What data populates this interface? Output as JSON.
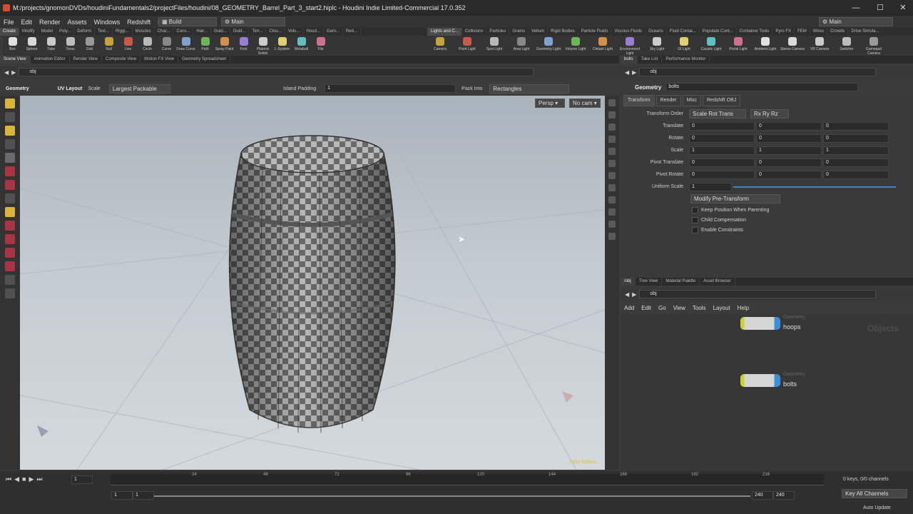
{
  "window": {
    "title": "M:/projects/gnomonDVDs/houdiniFundamentals2/projectFiles/houdini/08_GEOMETRY_Barrel_Part_3_start2.hiplc - Houdini Indie Limited-Commercial 17.0.352",
    "minimize": "—",
    "maximize": "☐",
    "close": "✕"
  },
  "menu": [
    "File",
    "Edit",
    "Render",
    "Assets",
    "Windows",
    "Redshift",
    "Help"
  ],
  "desktop": {
    "label": "Build"
  },
  "main_desk": {
    "label": "Main"
  },
  "right_desk": {
    "label": "Main"
  },
  "shelf_left": {
    "tabs": [
      "Create",
      "Modify",
      "Model",
      "Poly...",
      "Deform",
      "Text...",
      "Riggi...",
      "Muscles",
      "Char...",
      "Cons...",
      "Hair...",
      "Guid...",
      "Guid...",
      "Terr...",
      "Clou...",
      "Volu...",
      "Houd...",
      "Gam...",
      "Red..."
    ],
    "tools": [
      "Box",
      "Sphere",
      "Tube",
      "Torus",
      "Grid",
      "Null",
      "Line",
      "Circle",
      "Curve",
      "Draw Curve",
      "Path",
      "Spray Paint",
      "Font",
      "Platonic Solids",
      "L-System",
      "Metaball",
      "File"
    ]
  },
  "shelf_right": {
    "tabs": [
      "Lights and C...",
      "Collisions",
      "Particles",
      "Grains",
      "Vellum",
      "Rigid Bodies",
      "Particle Fluids",
      "Viscous Fluids",
      "Oceans",
      "Fluid Contai...",
      "Populate Cont...",
      "Container Tools",
      "Pyro FX",
      "FEM",
      "Wires",
      "Crowds",
      "Drive Simula..."
    ],
    "tools": [
      "Camera",
      "Point Light",
      "Spot Light",
      "Area Light",
      "Geometry Light",
      "Volume Light",
      "Distant Light",
      "Environment Light",
      "Sky Light",
      "GI Light",
      "Caustic Light",
      "Portal Light",
      "Ambient Light",
      "Stereo Camera",
      "VR Camera",
      "Switcher",
      "Gamepad Camera"
    ]
  },
  "viewer": {
    "tabs": [
      "Scene View",
      "Animation Editor",
      "Render View",
      "Composite View",
      "Motion FX View",
      "Geometry Spreadsheet"
    ],
    "path": "obj",
    "toolbar": {
      "context": "Geometry",
      "tool": "UV Layout",
      "scale_label": "Scale",
      "scale_value": "Largest Packable",
      "island_label": "Island Padding",
      "island_value": "1",
      "pack_label": "Pack Into",
      "pack_value": "Rectangles"
    },
    "persp": "Persp ▾",
    "cam": "No cam ▾",
    "watermark": "Indie Edition"
  },
  "params": {
    "tabs": [
      "bolts",
      "Take List",
      "Performance Monitor"
    ],
    "path": "obj",
    "node_type": "Geometry",
    "node_name": "bolts",
    "subtabs": [
      "Transform",
      "Render",
      "Misc",
      "Redshift OBJ"
    ],
    "transform_order_label": "Transform Order",
    "transform_order": "Scale Rot Trans",
    "rot_order": "Rx Ry Rz",
    "rows": [
      {
        "label": "Translate",
        "v": [
          "0",
          "0",
          "0"
        ]
      },
      {
        "label": "Rotate",
        "v": [
          "0",
          "0",
          "0"
        ]
      },
      {
        "label": "Scale",
        "v": [
          "1",
          "1",
          "1"
        ]
      },
      {
        "label": "Pivot Translate",
        "v": [
          "0",
          "0",
          "0"
        ]
      },
      {
        "label": "Pivot Rotate",
        "v": [
          "0",
          "0",
          "0"
        ]
      }
    ],
    "uniform_label": "Uniform Scale",
    "uniform_value": "1",
    "modify": "Modify Pre-Transform",
    "checks": [
      "Keep Position When Parenting",
      "Child Compensation",
      "Enable Constraints"
    ]
  },
  "network": {
    "tabs": [
      "/obj",
      "Tree View",
      "Material Palette",
      "Asset Browser"
    ],
    "path": "obj",
    "menu": [
      "Add",
      "Edit",
      "Go",
      "View",
      "Tools",
      "Layout",
      "Help"
    ],
    "context_label": "Objects",
    "nodes": [
      {
        "type": "Geometry",
        "name": "hoops"
      },
      {
        "type": "Geometry",
        "name": "bolts"
      }
    ]
  },
  "timeline": {
    "current_frame": "1",
    "ticks": [
      "24",
      "48",
      "72",
      "96",
      "120",
      "144",
      "168",
      "192",
      "216"
    ],
    "start": "1",
    "start2": "1",
    "end": "240",
    "end2": "240",
    "keys": "0 keys, 0/0 channels",
    "key_all": "Key All Channels",
    "auto_update": "Auto Update"
  }
}
